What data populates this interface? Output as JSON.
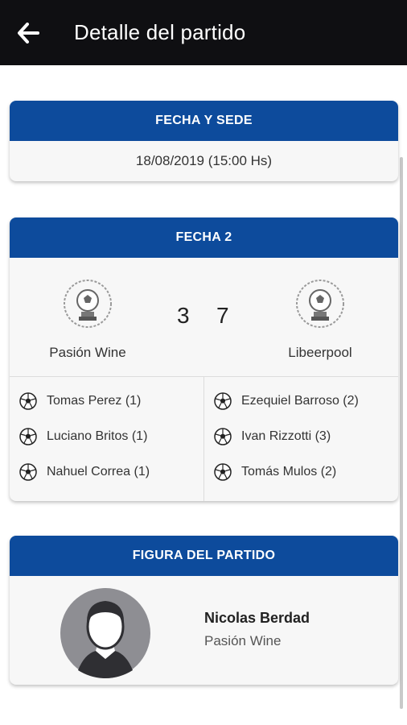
{
  "header": {
    "title": "Detalle del partido",
    "back_icon": "arrow-left-icon"
  },
  "colors": {
    "topbar": "#0f0f12",
    "card_header": "#0d4b9c",
    "card_bg": "#f7f7f7"
  },
  "fecha_sede": {
    "title": "FECHA Y SEDE",
    "datetime": "18/08/2019 (15:00 Hs)"
  },
  "match": {
    "title": "FECHA 2",
    "home": {
      "name": "Pasión Wine",
      "score": "3",
      "logo_icon": "trophy-crest-icon"
    },
    "away": {
      "name": "Libeerpool",
      "score": "7",
      "logo_icon": "trophy-crest-icon"
    },
    "home_scorers": [
      {
        "name": "Tomas Perez (1)"
      },
      {
        "name": "Luciano Britos (1)"
      },
      {
        "name": "Nahuel Correa (1)"
      }
    ],
    "away_scorers": [
      {
        "name": "Ezequiel Barroso (2)"
      },
      {
        "name": "Ivan Rizzotti (3)"
      },
      {
        "name": "Tomás Mulos (2)"
      }
    ]
  },
  "figura": {
    "title": "FIGURA DEL PARTIDO",
    "player_name": "Nicolas Berdad",
    "player_team": "Pasión Wine",
    "avatar_icon": "user-avatar-icon"
  }
}
